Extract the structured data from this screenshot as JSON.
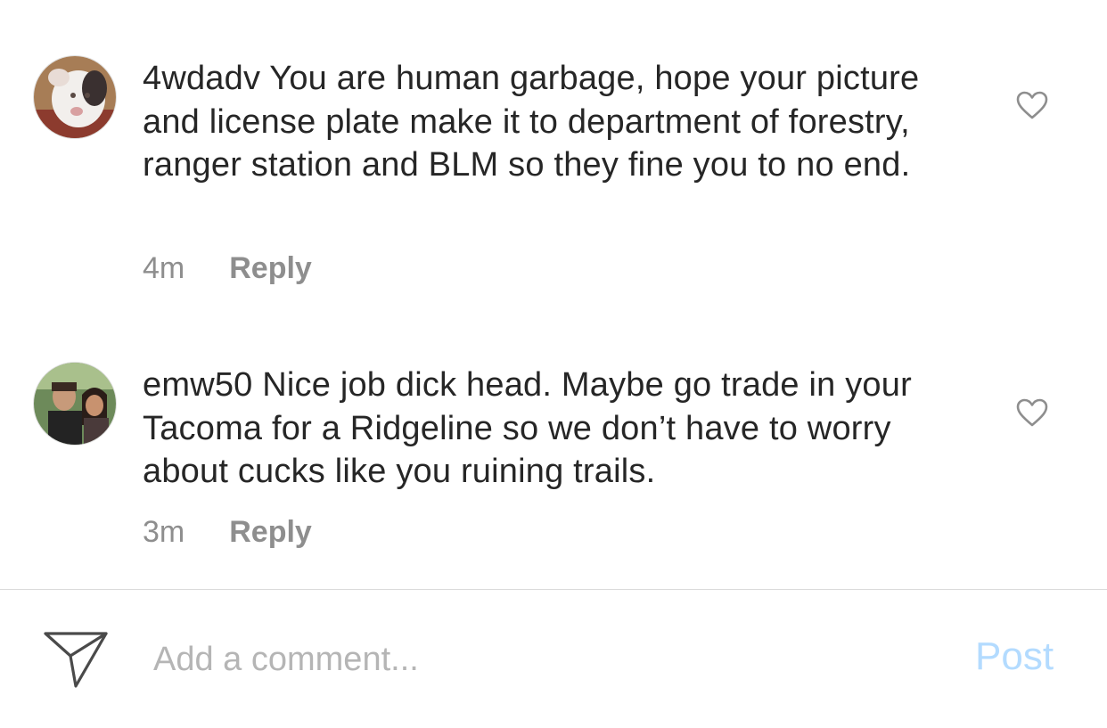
{
  "comments": [
    {
      "username": "4wdadv",
      "text": " You are human garbage, hope your picture and license plate make it to department of forestry, ranger station and BLM so they fine you to no end.",
      "time": "4m",
      "reply_label": "Reply",
      "avatar_icon": "dog-avatar"
    },
    {
      "username": "emw50",
      "text": " Nice job dick head. Maybe go trade in your Tacoma for a Ridgeline so we don’t have to worry about cucks like you ruining trails.",
      "time": "3m",
      "reply_label": "Reply",
      "avatar_icon": "couple-photo-avatar"
    }
  ],
  "composer": {
    "placeholder": "Add a comment...",
    "post_label": "Post",
    "send_icon": "paper-plane-icon"
  },
  "colors": {
    "text": "#262626",
    "meta": "#8e8e8e",
    "post_disabled": "#b3dbff",
    "divider": "#dbdbdb"
  }
}
